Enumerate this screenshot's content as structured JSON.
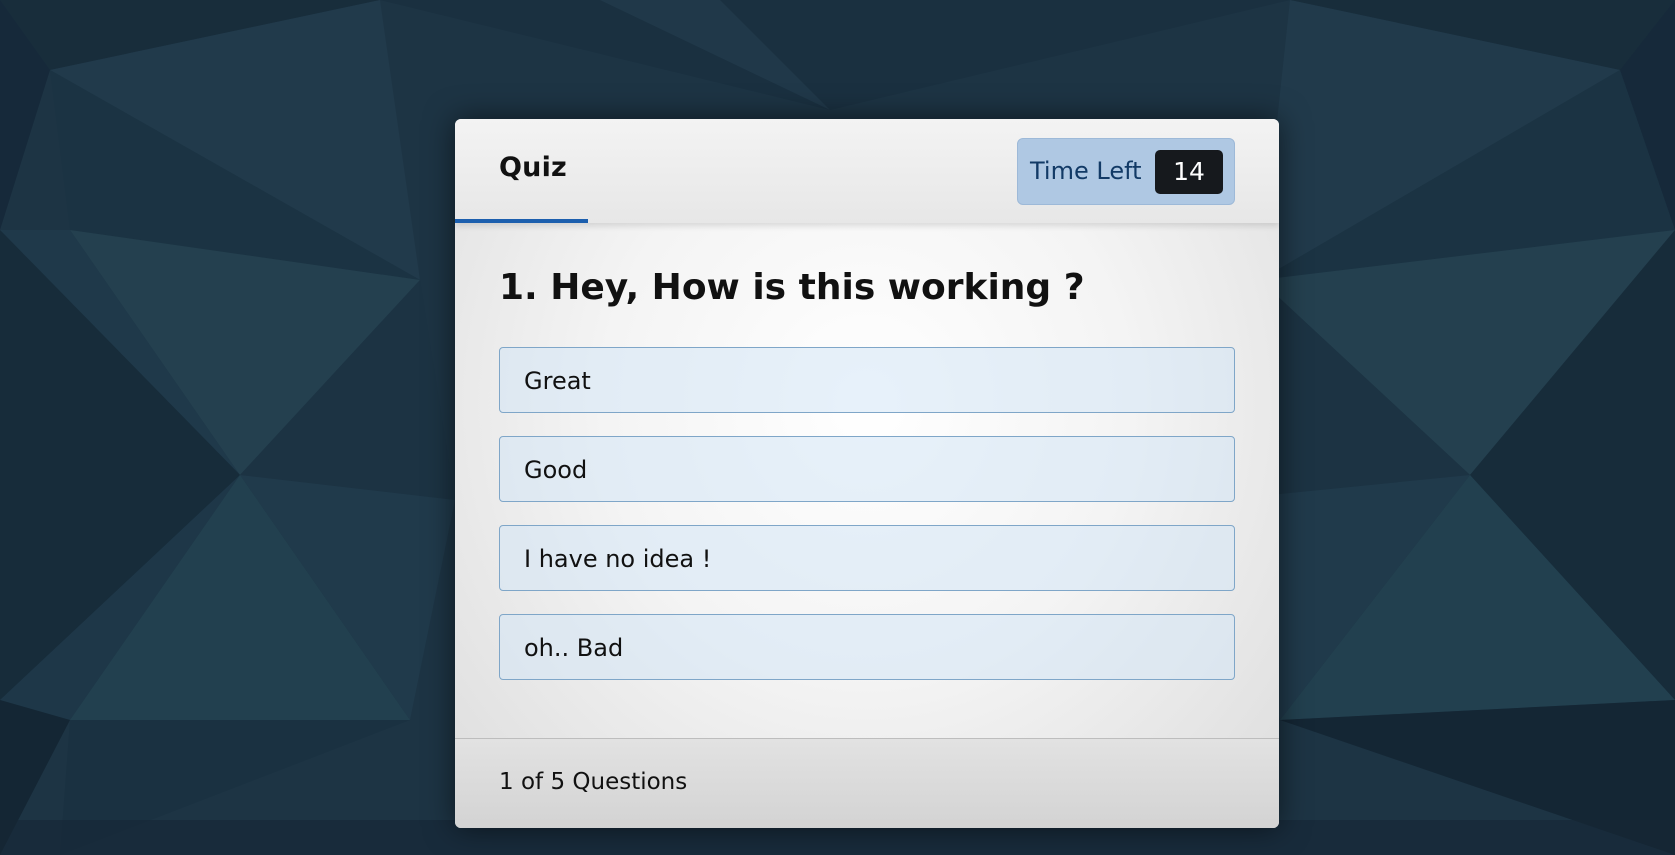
{
  "header": {
    "title": "Quiz",
    "timer_label": "Time Left",
    "timer_value": "14"
  },
  "question": {
    "text": "1. Hey, How is this working ?"
  },
  "options": [
    {
      "label": "Great"
    },
    {
      "label": "Good"
    },
    {
      "label": "I have no idea !"
    },
    {
      "label": "oh.. Bad"
    }
  ],
  "footer": {
    "current": "1",
    "of_text": "of",
    "total": "5",
    "suffix": "Questions"
  },
  "colors": {
    "background": "#1d3444",
    "accent": "#1c5fae",
    "timer_badge": "#afc8e3",
    "timer_count": "#16191d",
    "option_border": "#7fa6c8"
  }
}
